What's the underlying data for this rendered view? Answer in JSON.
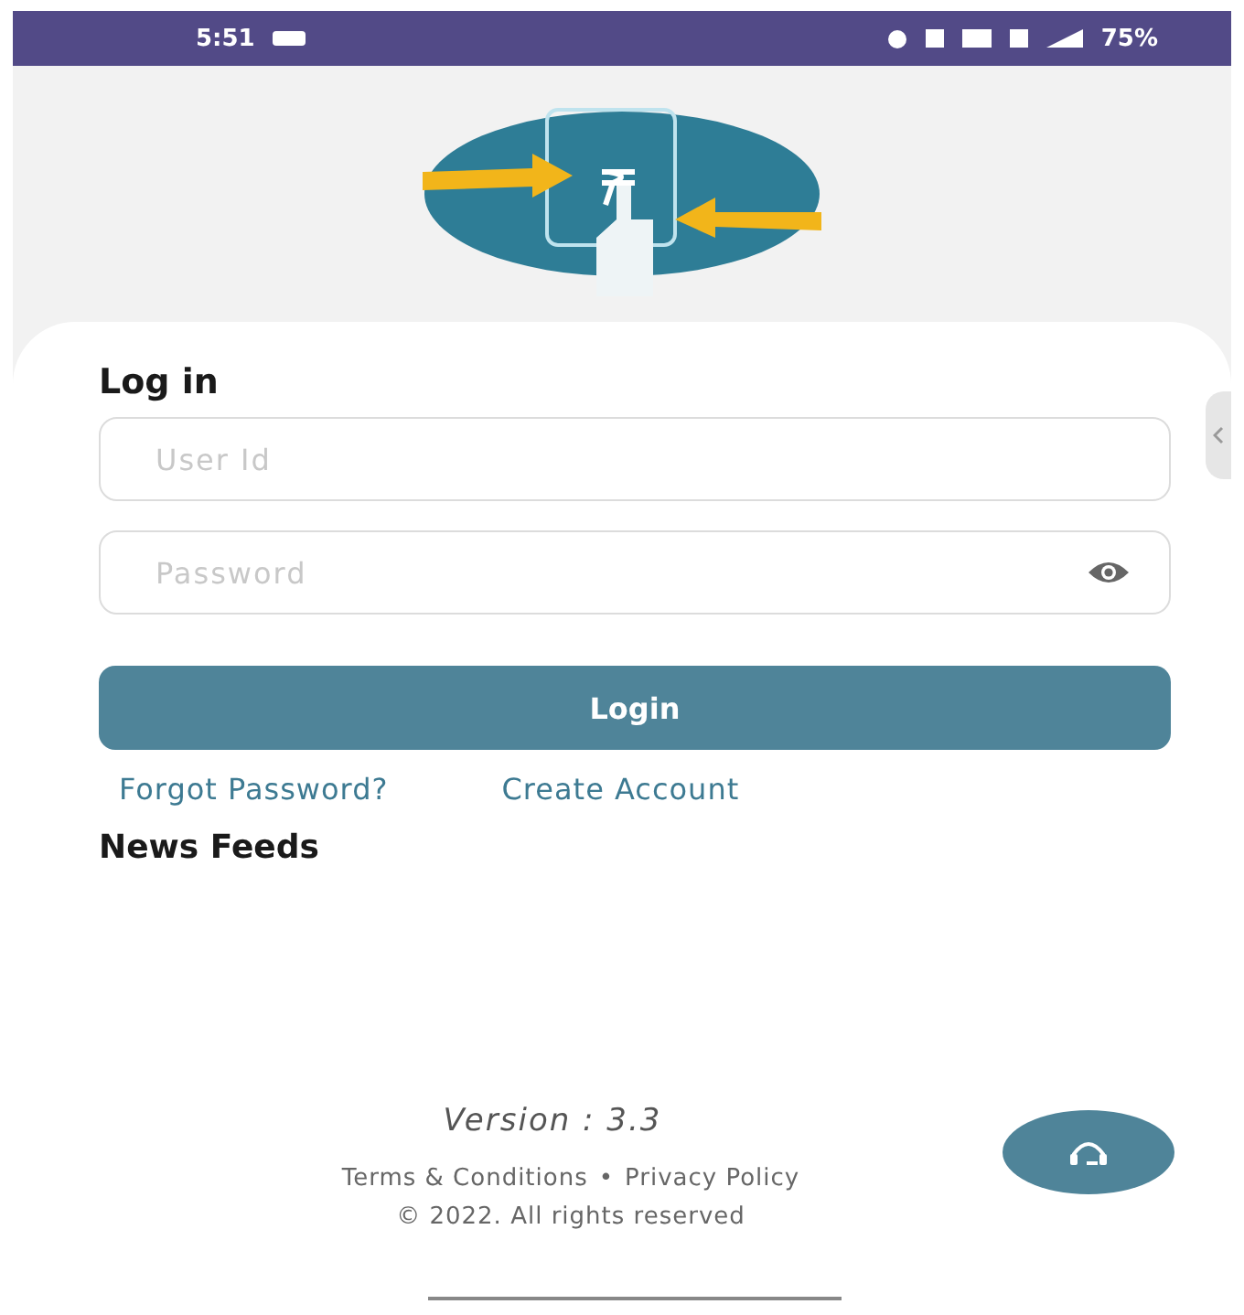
{
  "status_bar": {
    "time": "5:51",
    "battery": "75%"
  },
  "login": {
    "title": "Log in",
    "user_field": {
      "placeholder": "User Id"
    },
    "password_field": {
      "placeholder": "Password"
    },
    "button": "Login",
    "links": [
      "Forgot Password?",
      "Create Account"
    ]
  },
  "news_feeds": {
    "title": "News Feeds"
  },
  "footer": {
    "version": "Version : 3.3",
    "links": [
      "Terms & Conditions",
      "Privacy Policy"
    ],
    "separator": "•",
    "copyright": "© 2022. All rights reserved"
  }
}
